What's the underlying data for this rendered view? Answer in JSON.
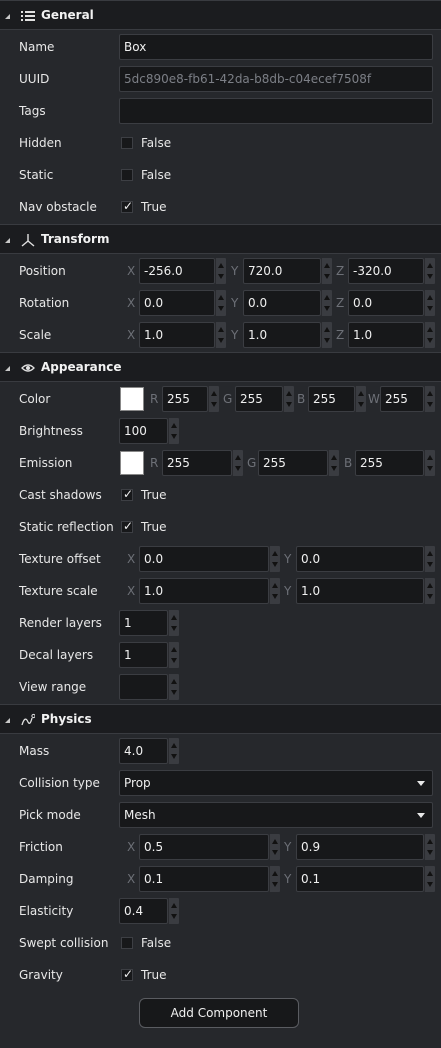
{
  "general": {
    "title": "General",
    "name_label": "Name",
    "name_value": "Box",
    "uuid_label": "UUID",
    "uuid_value": "5dc890e8-fb61-42da-b8db-c04ecef7508f",
    "tags_label": "Tags",
    "tags_value": "",
    "hidden_label": "Hidden",
    "hidden_value": "False",
    "hidden_checked": false,
    "static_label": "Static",
    "static_value": "False",
    "static_checked": false,
    "nav_label": "Nav obstacle",
    "nav_value": "True",
    "nav_checked": true
  },
  "transform": {
    "title": "Transform",
    "position_label": "Position",
    "position": {
      "x": "-256.0",
      "y": "720.0",
      "z": "-320.0"
    },
    "rotation_label": "Rotation",
    "rotation": {
      "x": "0.0",
      "y": "0.0",
      "z": "0.0"
    },
    "scale_label": "Scale",
    "scale": {
      "x": "1.0",
      "y": "1.0",
      "z": "1.0"
    }
  },
  "appearance": {
    "title": "Appearance",
    "color_label": "Color",
    "color": {
      "r": "255",
      "g": "255",
      "b": "255",
      "w": "255"
    },
    "brightness_label": "Brightness",
    "brightness": "100",
    "emission_label": "Emission",
    "emission": {
      "r": "255",
      "g": "255",
      "b": "255"
    },
    "cast_shadows_label": "Cast shadows",
    "cast_shadows_value": "True",
    "static_reflection_label": "Static reflection",
    "static_reflection_value": "True",
    "texture_offset_label": "Texture offset",
    "texture_offset": {
      "x": "0.0",
      "y": "0.0"
    },
    "texture_scale_label": "Texture scale",
    "texture_scale": {
      "x": "1.0",
      "y": "1.0"
    },
    "render_layers_label": "Render layers",
    "render_layers": "1",
    "decal_layers_label": "Decal layers",
    "decal_layers": "1",
    "view_range_label": "View range",
    "view_range": ""
  },
  "physics": {
    "title": "Physics",
    "mass_label": "Mass",
    "mass": "4.0",
    "collision_type_label": "Collision type",
    "collision_type": "Prop",
    "pick_mode_label": "Pick mode",
    "pick_mode": "Mesh",
    "friction_label": "Friction",
    "friction": {
      "x": "0.5",
      "y": "0.9"
    },
    "damping_label": "Damping",
    "damping": {
      "x": "0.1",
      "y": "0.1"
    },
    "elasticity_label": "Elasticity",
    "elasticity": "0.4",
    "swept_label": "Swept collision",
    "swept_value": "False",
    "gravity_label": "Gravity",
    "gravity_value": "True"
  },
  "axes": {
    "x": "X",
    "y": "Y",
    "z": "Z",
    "r": "R",
    "g": "G",
    "b": "B",
    "w": "W"
  },
  "add_component_label": "Add Component",
  "colors": {
    "panel": "#26282c",
    "header": "#1b1c1f",
    "field": "#17181a",
    "swatch": "#ffffff"
  }
}
